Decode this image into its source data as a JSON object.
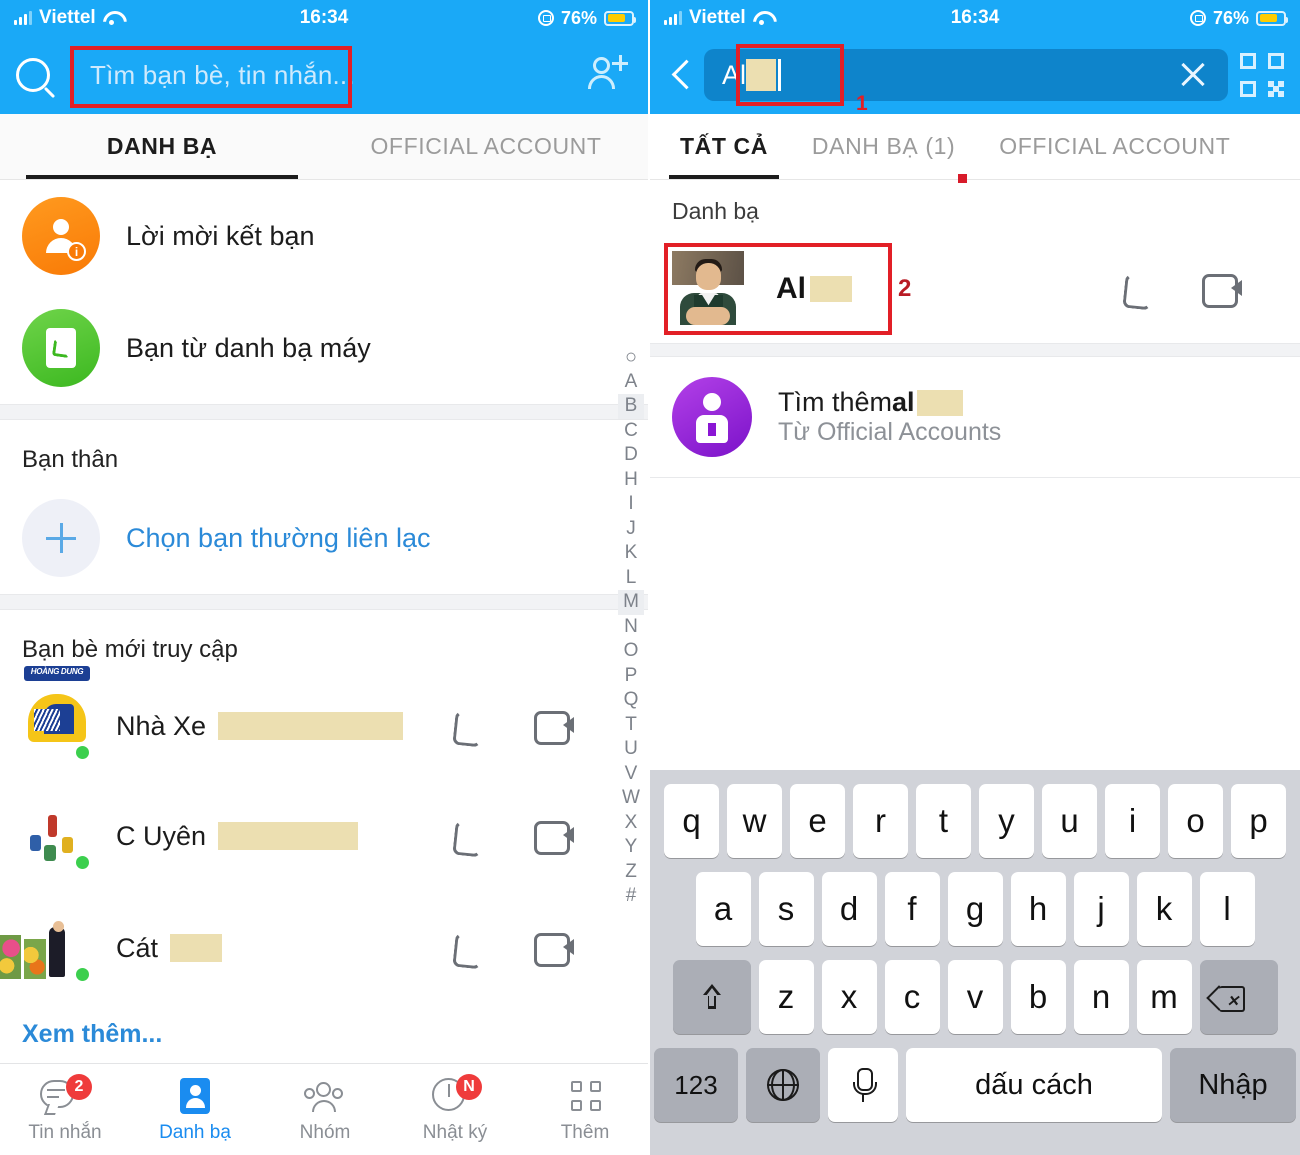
{
  "status_bar": {
    "carrier": "Viettel",
    "time": "16:34",
    "battery_percent": "76%",
    "signal_icon": "signal-bars-icon",
    "wifi_icon": "wifi-icon",
    "rotation_lock_icon": "rotation-lock-icon",
    "battery_icon": "battery-icon"
  },
  "left": {
    "search": {
      "placeholder": "Tìm bạn bè, tin nhắn...",
      "search_icon": "search-icon",
      "add_friend_icon": "add-friend-icon"
    },
    "tabs": [
      {
        "label": "DANH BẠ",
        "active": true
      },
      {
        "label": "OFFICIAL ACCOUNT",
        "active": false
      }
    ],
    "menu": [
      {
        "label": "Lời mời kết bạn",
        "icon": "friend-request-icon"
      },
      {
        "label": "Bạn từ danh bạ máy",
        "icon": "phonebook-icon"
      }
    ],
    "sections": {
      "best_friends_title": "Bạn thân",
      "pick_friend_label": "Chọn bạn thường liên lạc",
      "recent_title": "Bạn bè mới truy cập"
    },
    "contacts": [
      {
        "name": "Nhà Xe",
        "redacted_width": 185,
        "avatar": "bus-logo-avatar",
        "online": true
      },
      {
        "name": "C Uyên",
        "redacted_width": 140,
        "avatar": "schoolyard-avatar",
        "online": true
      },
      {
        "name": "Cát",
        "redacted_width": 52,
        "avatar": "man-flowers-avatar",
        "online": true
      }
    ],
    "see_more": "Xem thêm...",
    "alphabet_index": [
      "A",
      "B",
      "C",
      "D",
      "H",
      "I",
      "J",
      "K",
      "L",
      "M",
      "N",
      "O",
      "P",
      "Q",
      "T",
      "U",
      "V",
      "W",
      "X",
      "Y",
      "Z",
      "#"
    ],
    "alphabet_highlight": [
      "B",
      "M"
    ],
    "bottom_nav": [
      {
        "label": "Tin nhắn",
        "icon": "messages-icon",
        "badge": "2",
        "active": false
      },
      {
        "label": "Danh bạ",
        "icon": "contacts-icon",
        "badge": "",
        "active": true
      },
      {
        "label": "Nhóm",
        "icon": "groups-icon",
        "badge": "",
        "active": false
      },
      {
        "label": "Nhật ký",
        "icon": "timeline-icon",
        "badge": "N",
        "active": false
      },
      {
        "label": "Thêm",
        "icon": "more-grid-icon",
        "badge": "",
        "active": false
      }
    ]
  },
  "right": {
    "search": {
      "back_icon": "back-chevron-icon",
      "value": "Al",
      "redacted_width": 30,
      "clear_icon": "clear-x-icon",
      "qr_icon": "qr-code-icon",
      "annotation": "1"
    },
    "tabs": [
      {
        "label": "TẤT CẢ",
        "active": true
      },
      {
        "label": "DANH BẠ (1)",
        "active": false
      },
      {
        "label": "OFFICIAL ACCOUNT",
        "active": false
      }
    ],
    "section_label": "Danh bạ",
    "result": {
      "name": "Al",
      "redacted_width": 42,
      "avatar": "man-portrait-avatar",
      "annotation": "2",
      "call_icon": "phone-call-icon",
      "video_icon": "video-call-icon"
    },
    "official_account": {
      "title_prefix": "Tìm thêm ",
      "title_query": "al",
      "redacted_width": 46,
      "subtitle": "Từ Official Accounts",
      "icon": "official-account-icon"
    },
    "keyboard": {
      "row1": [
        "q",
        "w",
        "e",
        "r",
        "t",
        "y",
        "u",
        "i",
        "o",
        "p"
      ],
      "row2": [
        "a",
        "s",
        "d",
        "f",
        "g",
        "h",
        "j",
        "k",
        "l"
      ],
      "row3": [
        "z",
        "x",
        "c",
        "v",
        "b",
        "n",
        "m"
      ],
      "shift_icon": "shift-icon",
      "delete_icon": "backspace-icon",
      "numbers_key": "123",
      "globe_icon": "globe-icon",
      "mic_icon": "microphone-icon",
      "space_key": "dấu cách",
      "enter_key": "Nhập"
    }
  },
  "colors": {
    "header_blue": "#1aa9f7",
    "accent_blue": "#1a8cf0",
    "annotation_red": "#e21f26",
    "badge_red": "#ef3b3b",
    "redaction": "#ecdfb1",
    "keyboard_bg": "#d1d3d9"
  }
}
